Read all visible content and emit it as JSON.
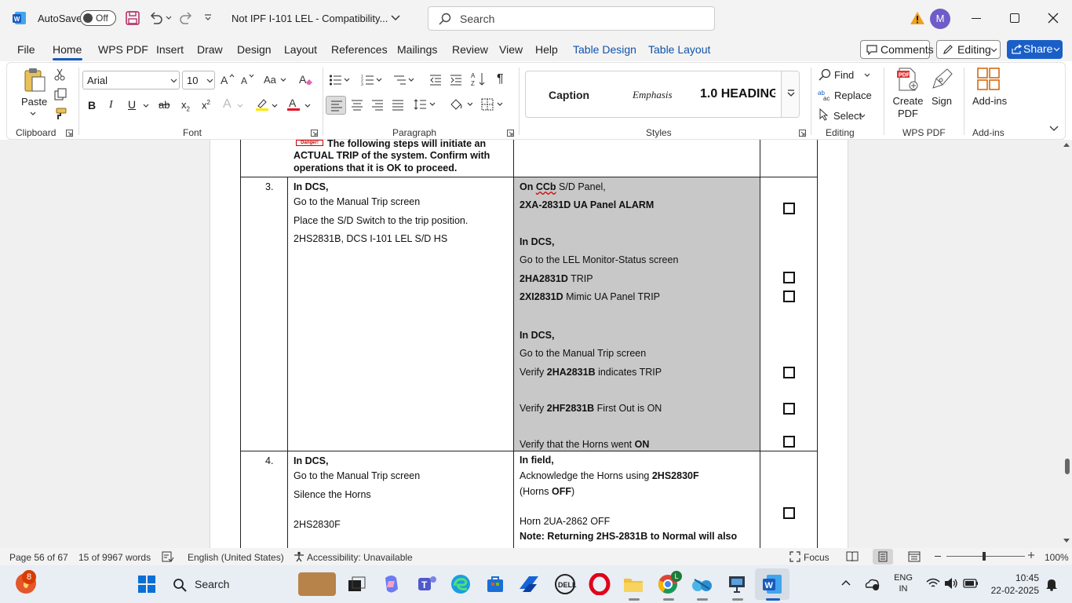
{
  "titlebar": {
    "autosave_label": "AutoSave",
    "autosave_state": "Off",
    "doc_title": "Not IPF I-101 LEL  -  Compatibility...",
    "search_placeholder": "Search",
    "avatar_initial": "M"
  },
  "menu": {
    "items": [
      "File",
      "Home",
      "WPS PDF",
      "Insert",
      "Draw",
      "Design",
      "Layout",
      "References",
      "Mailings",
      "Review",
      "View",
      "Help",
      "Table Design",
      "Table Layout"
    ],
    "comments_label": "Comments",
    "editing_label": "Editing",
    "share_label": "Share"
  },
  "ribbon": {
    "clipboard": {
      "paste_label": "Paste",
      "group_label": "Clipboard"
    },
    "font": {
      "font_name": "Arial",
      "font_size": "10",
      "group_label": "Font"
    },
    "paragraph": {
      "group_label": "Paragraph"
    },
    "styles": {
      "items": [
        "Caption",
        "Emphasis",
        "1.0  HEADING"
      ],
      "group_label": "Styles"
    },
    "editing": {
      "find": "Find",
      "replace": "Replace",
      "select": "Select",
      "group_label": "Editing"
    },
    "wpspdf": {
      "create_pdf": "Create PDF",
      "sign": "Sign",
      "group_label": "WPS PDF"
    },
    "addins": {
      "label": "Add-ins",
      "group_label": "Add-ins"
    }
  },
  "document": {
    "top_row": {
      "danger_label": "Danger!",
      "line1": "The following steps will initiate an",
      "line2": "ACTUAL TRIP of the system. Confirm with",
      "line3": "operations that it is OK to proceed."
    },
    "row3": {
      "num": "3.",
      "action_lines": [
        "In DCS,",
        "Go to the Manual Trip screen",
        "Place the S/D Switch to the trip position.",
        "2HS2831B, DCS I-101 LEL S/D HS"
      ],
      "verify": {
        "l1a": "On ",
        "l1b": "CCb",
        "l1c": " S/D Panel,",
        "l2": "2XA-2831D UA Panel ALARM",
        "l3": "In DCS,",
        "l4": "Go to the LEL Monitor-Status screen",
        "l5a": "2HA2831D",
        "l5b": " TRIP",
        "l6a": "2XI2831D",
        "l6b": " Mimic UA Panel TRIP",
        "l7": "In DCS,",
        "l8": "Go to the Manual Trip screen",
        "l9a": "Verify ",
        "l9b": "2HA2831B",
        "l9c": " indicates TRIP",
        "l10a": "Verify ",
        "l10b": "2HF2831B",
        "l10c": " First Out is ON",
        "l11a": "Verify that the Horns went ",
        "l11b": "ON"
      }
    },
    "row4": {
      "num": "4.",
      "action_lines": [
        "In DCS,",
        "Go to the Manual Trip screen",
        "Silence the Horns",
        "2HS2830F"
      ],
      "verify": {
        "l1": "In field,",
        "l2a": "Acknowledge the Horns using ",
        "l2b": "2HS2830F",
        "l3a": "(Horns ",
        "l3b": "OFF",
        "l3c": ")",
        "l4": "Horn 2UA-2862 OFF",
        "l5": "Note: Returning 2HS-2831B to Normal will also"
      }
    }
  },
  "statusbar": {
    "page": "Page 56 of 67",
    "words": "15 of 9967 words",
    "language": "English (United States)",
    "accessibility": "Accessibility: Unavailable",
    "focus": "Focus",
    "zoom": "100%"
  },
  "taskbar": {
    "badge_count": "8",
    "search_label": "Search",
    "lang_line1": "ENG",
    "lang_line2": "IN",
    "time": "10:45",
    "date": "22-02-2025"
  },
  "colors": {
    "accent": "#1152a8",
    "share_bg": "#1a5fc7",
    "shading": "#c8c8c8",
    "word_blue": "#185abd"
  }
}
